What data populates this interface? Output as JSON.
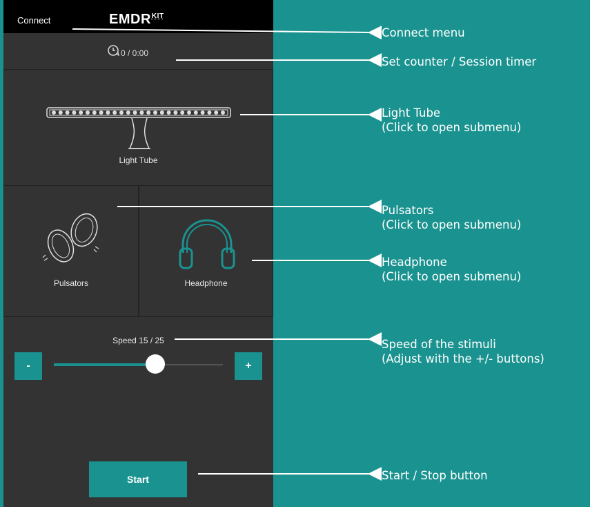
{
  "app": {
    "topbar": {
      "connect_label": "Connect",
      "logo_main": "EMDR",
      "logo_sup": "KIT"
    },
    "timer": {
      "text": "0 / 0:00",
      "icon": "clock-cycle-icon"
    },
    "tiles": {
      "light_tube": {
        "label": "Light Tube",
        "icon": "light-tube-icon"
      },
      "pulsators": {
        "label": "Pulsators",
        "icon": "pulsators-icon"
      },
      "headphone": {
        "label": "Headphone",
        "icon": "headphone-icon"
      }
    },
    "speed": {
      "label": "Speed 15 / 25",
      "value": 15,
      "max": 25,
      "minus_label": "-",
      "plus_label": "+"
    },
    "start_label": "Start"
  },
  "annotations": [
    "Connect menu",
    "Set counter / Session timer",
    "Light Tube\n(Click to open submenu)",
    "Pulsators\n(Click to open submenu)",
    "Headphone\n(Click to open submenu)",
    "Speed of the stimuli\n(Adjust with the +/- buttons)",
    "Start / Stop button"
  ],
  "colors": {
    "accent": "#1a9390",
    "panel": "#333333",
    "topbar": "#000000",
    "text": "#ffffff"
  }
}
